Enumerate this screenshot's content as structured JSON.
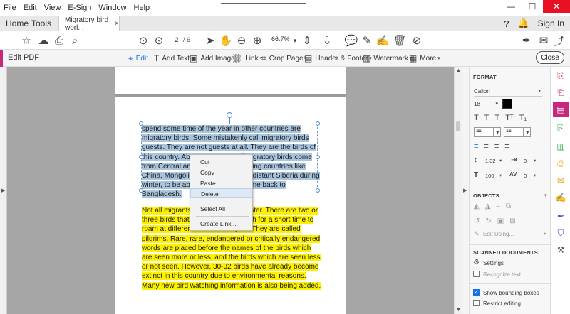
{
  "menu": [
    "File",
    "Edit",
    "View",
    "E-Sign",
    "Window",
    "Help"
  ],
  "window_controls": {
    "minimize": "—",
    "maximize": "☐",
    "close": "✕"
  },
  "tabs": {
    "home": "Home",
    "tools": "Tools",
    "doc": "Migratory bird worl...",
    "doc_close": "×"
  },
  "account": {
    "sign_in": "Sign In"
  },
  "toolbar": {
    "page_current": "2",
    "page_total": "/ 6",
    "zoom": "66.7%"
  },
  "edit_bar": {
    "label": "Edit PDF",
    "edit": "Edit",
    "add_text": "Add Text",
    "add_image": "Add Image",
    "link": "Link",
    "crop_pages": "Crop Pages",
    "header_footer": "Header & Footer",
    "watermark": "Watermark",
    "more": "More",
    "close": "Close"
  },
  "document": {
    "selected_paragraph": "spend some time of the year in other countries are migratory birds. Some mistakenly call migratory birds guests. They are not guests at all. They are the birds of this country. About 80 percent of migratory birds come from Central and North Asia, including countries like China, Mongolia and 20 percent to distant Siberia during winter, to be able to survive. He came back to Bangladesh.",
    "highlighted_paragraph": "Not all migrants come to stay in winter. There are two or three birds that come to Bangladesh for a short time to roam at different times of the year. They are called pilgrims. Rare, rare, endangered or critically endangered words are placed before the names of the birds which are seen more or less, and the birds which are seen less or not seen. However, 30-32 birds have already become extinct in this country due to environmental reasons. Many new bird watching information is also being added."
  },
  "context_menu": {
    "cut": "Cut",
    "copy": "Copy",
    "paste": "Paste",
    "delete": "Delete",
    "select_all": "Select All",
    "create_link": "Create Link..."
  },
  "panel": {
    "format_heading": "FORMAT",
    "font": "Calibri",
    "font_size": "18",
    "line_spacing": "1.32",
    "indent": "0",
    "scale": "100",
    "char_spacing": "0",
    "objects_heading": "OBJECTS",
    "edit_using": "Edit Using...",
    "scanned_heading": "SCANNED DOCUMENTS",
    "settings": "Settings",
    "recognize_text": "Recognize text",
    "show_bounding_boxes": "Show bounding boxes",
    "restrict_editing": "Restrict editing"
  },
  "colors": {
    "accent": "#c6287c",
    "selection": "#a9c4dd",
    "highlight": "#fff200",
    "link_blue": "#1473e6"
  }
}
